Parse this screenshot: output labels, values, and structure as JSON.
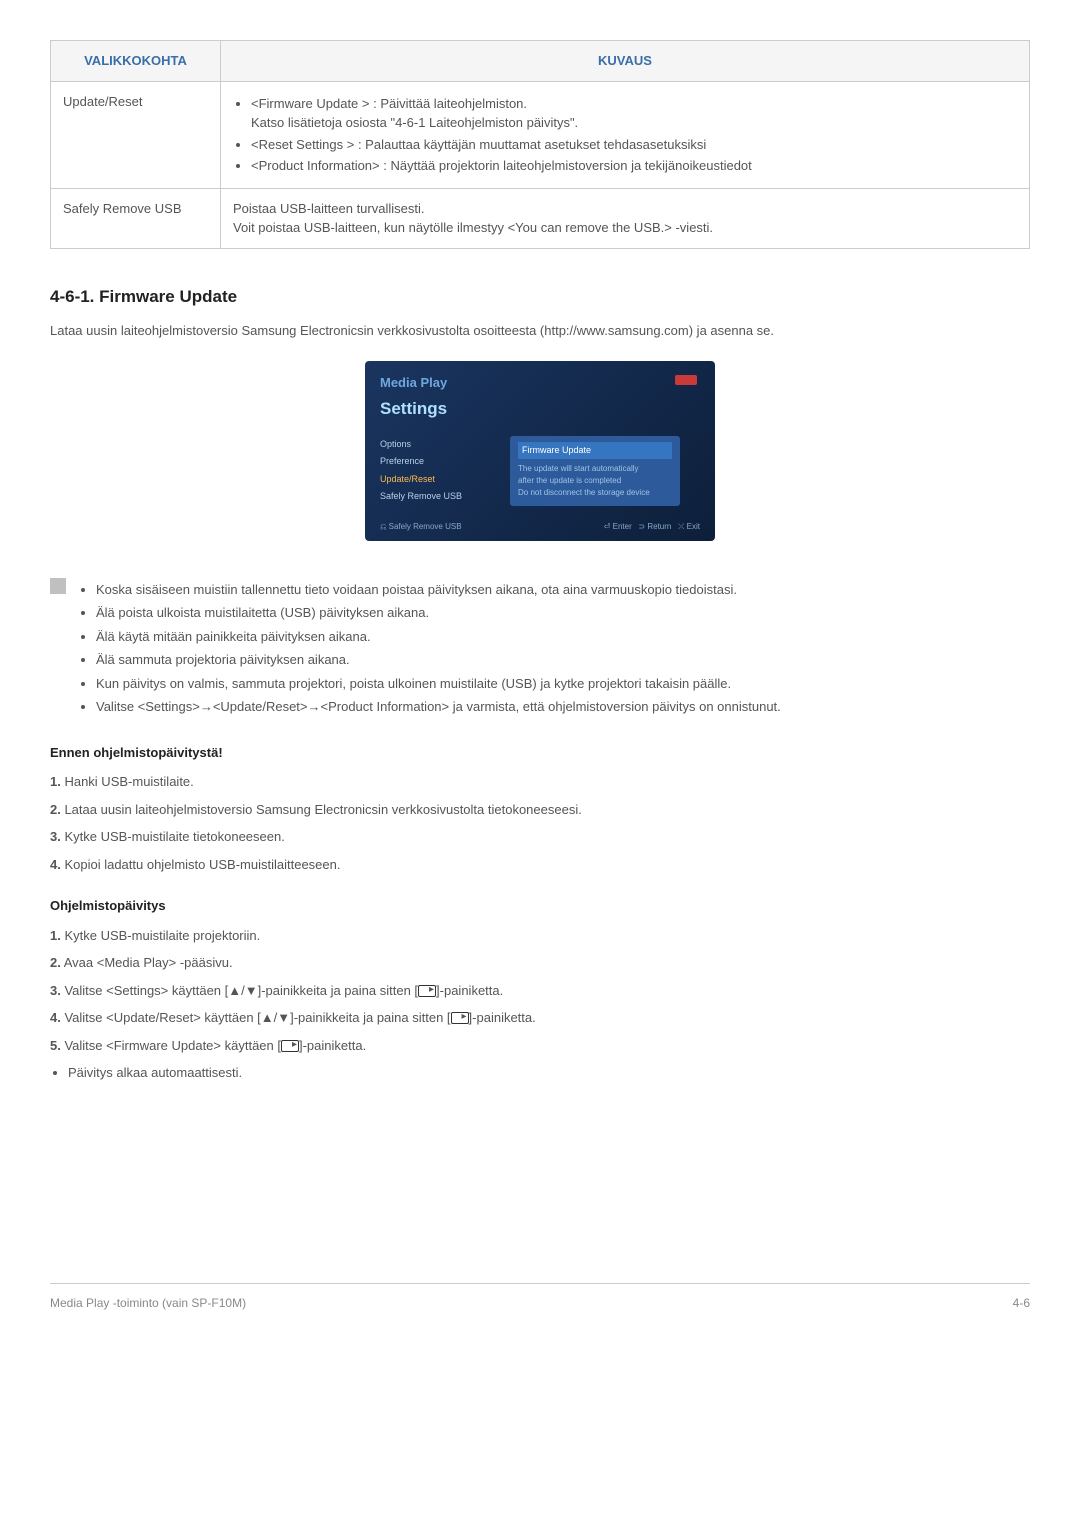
{
  "table": {
    "header_menu": "VALIKKOKOHTA",
    "header_desc": "KUVAUS",
    "row1_label": "Update/Reset",
    "row1_b1": "<Firmware Update > : Päivittää laiteohjelmiston.",
    "row1_b1_sub": "Katso lisätietoja osiosta \"4-6-1 Laiteohjelmiston päivitys\".",
    "row1_b2": "<Reset Settings > : Palauttaa käyttäjän muuttamat asetukset tehdasasetuksiksi",
    "row1_b3": "<Product Information> : Näyttää projektorin laiteohjelmistoversion ja tekijänoikeustiedot",
    "row2_label": "Safely Remove USB",
    "row2_l1": "Poistaa USB-laitteen turvallisesti.",
    "row2_l2": "Voit poistaa USB-laitteen, kun näytölle ilmestyy <You can remove the USB.> -viesti."
  },
  "section_title": "4-6-1. Firmware Update",
  "section_intro": "Lataa uusin laiteohjelmistoversio Samsung Electronicsin verkkosivustolta osoitteesta (http://www.samsung.com) ja asenna se.",
  "screenshot": {
    "media_play": "Media Play",
    "settings": "Settings",
    "opt": "Options",
    "pref": "Preference",
    "upd": "Update/Reset",
    "safe": "Safely Remove USB",
    "fw": "Firmware Update",
    "msg1": "The update will start automatically",
    "msg2": "after the update is completed",
    "msg3": "Do not disconnect the storage device",
    "bottom_left": "⎌ Safely Remove USB",
    "bottom_enter": "⏎ Enter",
    "bottom_return": "⊃ Return",
    "bottom_exit": "⤫ Exit"
  },
  "notes": {
    "n1": "Koska sisäiseen muistiin tallennettu tieto voidaan poistaa päivityksen aikana, ota aina varmuuskopio tiedoistasi.",
    "n2": "Älä poista ulkoista muistilaitetta (USB) päivityksen aikana.",
    "n3": "Älä käytä mitään painikkeita päivityksen aikana.",
    "n4": "Älä sammuta projektoria päivityksen aikana.",
    "n5": "Kun päivitys on valmis, sammuta projektori, poista ulkoinen muistilaite (USB) ja kytke projektori takaisin päälle.",
    "n6": "Valitse <Settings>→<Update/Reset>→<Product Information> ja varmista, että ohjelmistoversion päivitys on onnistunut."
  },
  "before": {
    "title": "Ennen ohjelmistopäivitystä!",
    "s1n": "1.",
    "s1": " Hanki USB-muistilaite.",
    "s2n": "2.",
    "s2": " Lataa uusin laiteohjelmistoversio Samsung Electronicsin verkkosivustolta tietokoneeseesi.",
    "s3n": "3.",
    "s3": " Kytke USB-muistilaite tietokoneeseen.",
    "s4n": "4.",
    "s4": " Kopioi ladattu ohjelmisto USB-muistilaitteeseen."
  },
  "update": {
    "title": "Ohjelmistopäivitys",
    "s1n": "1.",
    "s1": " Kytke USB-muistilaite projektoriin.",
    "s2n": "2.",
    "s2": " Avaa <Media Play> -pääsivu.",
    "s3n": "3.",
    "s3a": " Valitse <Settings> käyttäen [▲/▼]-painikkeita ja paina sitten [",
    "s3b": "]-painiketta.",
    "s4n": "4.",
    "s4a": " Valitse <Update/Reset> käyttäen [▲/▼]-painikkeita ja paina sitten [",
    "s4b": "]-painiketta.",
    "s5n": "5.",
    "s5a": " Valitse <Firmware Update> käyttäen [",
    "s5b": "]-painiketta.",
    "s6": "Päivitys alkaa automaattisesti."
  },
  "footer": {
    "left": "Media Play -toiminto (vain SP-F10M)",
    "right": "4-6"
  }
}
